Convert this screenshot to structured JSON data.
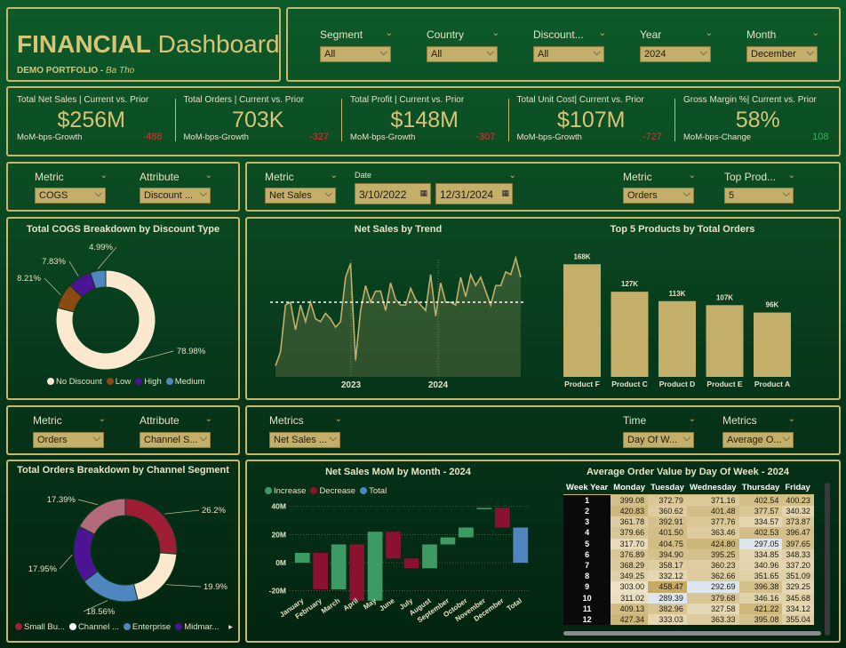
{
  "header": {
    "title_bold": "FINANCIAL",
    "title_rest": " Dashboard",
    "subtitle_bold": "DEMO PORTFOLIO - ",
    "subtitle_italic": "Ba Tho"
  },
  "top_slicers": [
    {
      "label": "Segment",
      "value": "All"
    },
    {
      "label": "Country",
      "value": "All"
    },
    {
      "label": "Discount...",
      "value": "All"
    },
    {
      "label": "Year",
      "value": "2024"
    },
    {
      "label": "Month",
      "value": "December"
    }
  ],
  "kpis": [
    {
      "title": "Total Net Sales | Current vs. Prior",
      "value": "$256M",
      "footer": "MoM-bps-Growth",
      "delta": "-488",
      "dir": "neg"
    },
    {
      "title": "Total Orders | Current vs. Prior",
      "value": "703K",
      "footer": "MoM-bps-Growth",
      "delta": "-327",
      "dir": "neg"
    },
    {
      "title": "Total Profit | Current vs. Prior",
      "value": "$148M",
      "footer": "MoM-bps-Growth",
      "delta": "-307",
      "dir": "neg"
    },
    {
      "title": "Total Unit Cost| Current vs. Prior",
      "value": "$107M",
      "footer": "MoM-bps-Growth",
      "delta": "-727",
      "dir": "neg"
    },
    {
      "title": "Gross Margin %| Current vs. Prior",
      "value": "58%",
      "footer": "MoM-bps-Change",
      "delta": "108",
      "dir": "pos"
    }
  ],
  "row2_left": {
    "metric_label": "Metric",
    "metric_value": "COGS",
    "attribute_label": "Attribute",
    "attribute_value": "Discount ..."
  },
  "row2_right": {
    "metric_label": "Metric",
    "metric_value": "Net Sales",
    "date_label": "Date",
    "date_from": "3/10/2022",
    "date_to": "12/31/2024",
    "metric2_label": "Metric",
    "metric2_value": "Orders",
    "top_label": "Top Prod...",
    "top_value": "5"
  },
  "row4_left": {
    "metric_label": "Metric",
    "metric_value": "Orders",
    "attribute_label": "Attribute",
    "attribute_value": "Channel S..."
  },
  "row4_right": {
    "metrics_label": "Metrics",
    "metrics_value": "Net Sales ...",
    "time_label": "Time",
    "time_value": "Day Of W...",
    "metrics2_label": "Metrics",
    "metrics2_value": "Average O..."
  },
  "colors": {
    "gold": "#c3ae6a",
    "cream": "#fbe9cf",
    "brown": "#8a4a12",
    "purple": "#4c1394",
    "blue": "#4f86bf",
    "crimson": "#9e1f35",
    "rose": "#b46a7a",
    "increase": "#3d9a64",
    "decrease": "#8a1230",
    "total": "#4f86bf"
  },
  "chart_data": [
    {
      "type": "pie",
      "title": "Total COGS Breakdown by Discount Type",
      "categories": [
        "No Discount",
        "Low",
        "High",
        "Medium"
      ],
      "values": [
        78.98,
        8.21,
        7.83,
        4.99
      ],
      "labels": [
        "78.98%",
        "8.21%",
        "7.83%",
        "4.99%"
      ],
      "legend": "bottom"
    },
    {
      "type": "area",
      "title": "Net Sales by Trend",
      "x_ticks": [
        "2023",
        "2024"
      ],
      "values": [
        4,
        9,
        26,
        27,
        17,
        26,
        20,
        27,
        21,
        20,
        23,
        21,
        18,
        20,
        36,
        41,
        6,
        24,
        33,
        27,
        31,
        31,
        24,
        34,
        28,
        26,
        26,
        32,
        28,
        26,
        24,
        37,
        22,
        34,
        27,
        27,
        26,
        36,
        29,
        37,
        33,
        36,
        31,
        26,
        33,
        33,
        38,
        37,
        43,
        36
      ],
      "reference_line": 27
    },
    {
      "type": "bar",
      "title": "Top 5 Products by Total Orders",
      "categories": [
        "Product F",
        "Product C",
        "Product D",
        "Product E",
        "Product A"
      ],
      "values": [
        168,
        127,
        113,
        107,
        96
      ],
      "labels": [
        "168K",
        "127K",
        "113K",
        "107K",
        "96K"
      ]
    },
    {
      "type": "pie",
      "title": "Total Orders Breakdown by Channel Segment",
      "categories": [
        "Small Bu...",
        "Channel ...",
        "Enterprise",
        "Midmar..."
      ],
      "values": [
        26.2,
        19.9,
        18.56,
        17.95,
        17.39
      ],
      "labels": [
        "26.2%",
        "19.9%",
        "18.56%",
        "17.95%",
        "17.39%"
      ],
      "legend": "bottom"
    },
    {
      "type": "bar",
      "title": "Net Sales MoM by Month - 2024",
      "categories": [
        "January",
        "February",
        "March",
        "April",
        "May",
        "June",
        "July",
        "August",
        "September",
        "October",
        "November",
        "December",
        "Total"
      ],
      "series": [
        {
          "name": "Increase"
        },
        {
          "name": "Decrease"
        },
        {
          "name": "Total"
        }
      ],
      "starts": [
        0,
        7,
        -19,
        13,
        -27,
        22,
        3,
        -4,
        13,
        18,
        38,
        39,
        25
      ],
      "ends": [
        7,
        -19,
        13,
        -27,
        22,
        3,
        -4,
        13,
        18,
        25,
        39,
        25,
        0
      ],
      "y_ticks": [
        "40M",
        "20M",
        "0M",
        "-20M"
      ],
      "ylim": [
        -24,
        43
      ],
      "legend": "top-left"
    },
    {
      "type": "table",
      "title": "Average Order Value by Day Of Week - 2024",
      "columns": [
        "Week Year",
        "Monday",
        "Tuesday",
        "Wednesday",
        "Thursday",
        "Friday"
      ],
      "rows": [
        [
          "1",
          "399.08",
          "372.79",
          "371.16",
          "402.54",
          "400.23"
        ],
        [
          "2",
          "420.83",
          "360.62",
          "401.48",
          "377.57",
          "340.32"
        ],
        [
          "3",
          "361.78",
          "392.91",
          "377.76",
          "334.57",
          "373.87"
        ],
        [
          "4",
          "379.66",
          "401.50",
          "363.46",
          "402.53",
          "396.47"
        ],
        [
          "5",
          "317.70",
          "404.75",
          "424.80",
          "297.05",
          "397.65"
        ],
        [
          "6",
          "376.89",
          "394.90",
          "395.25",
          "334.85",
          "348.33"
        ],
        [
          "7",
          "368.29",
          "358.17",
          "360.23",
          "340.96",
          "337.20"
        ],
        [
          "8",
          "349.25",
          "332.12",
          "362.66",
          "351.65",
          "351.09"
        ],
        [
          "9",
          "303.00",
          "458.47",
          "292.69",
          "396.38",
          "329.25"
        ],
        [
          "10",
          "311.02",
          "289.39",
          "379.68",
          "346.16",
          "345.68"
        ],
        [
          "11",
          "409.13",
          "382.96",
          "327.58",
          "421.22",
          "334.12"
        ],
        [
          "12",
          "427.34",
          "333.03",
          "363.33",
          "395.08",
          "355.04"
        ]
      ]
    }
  ]
}
